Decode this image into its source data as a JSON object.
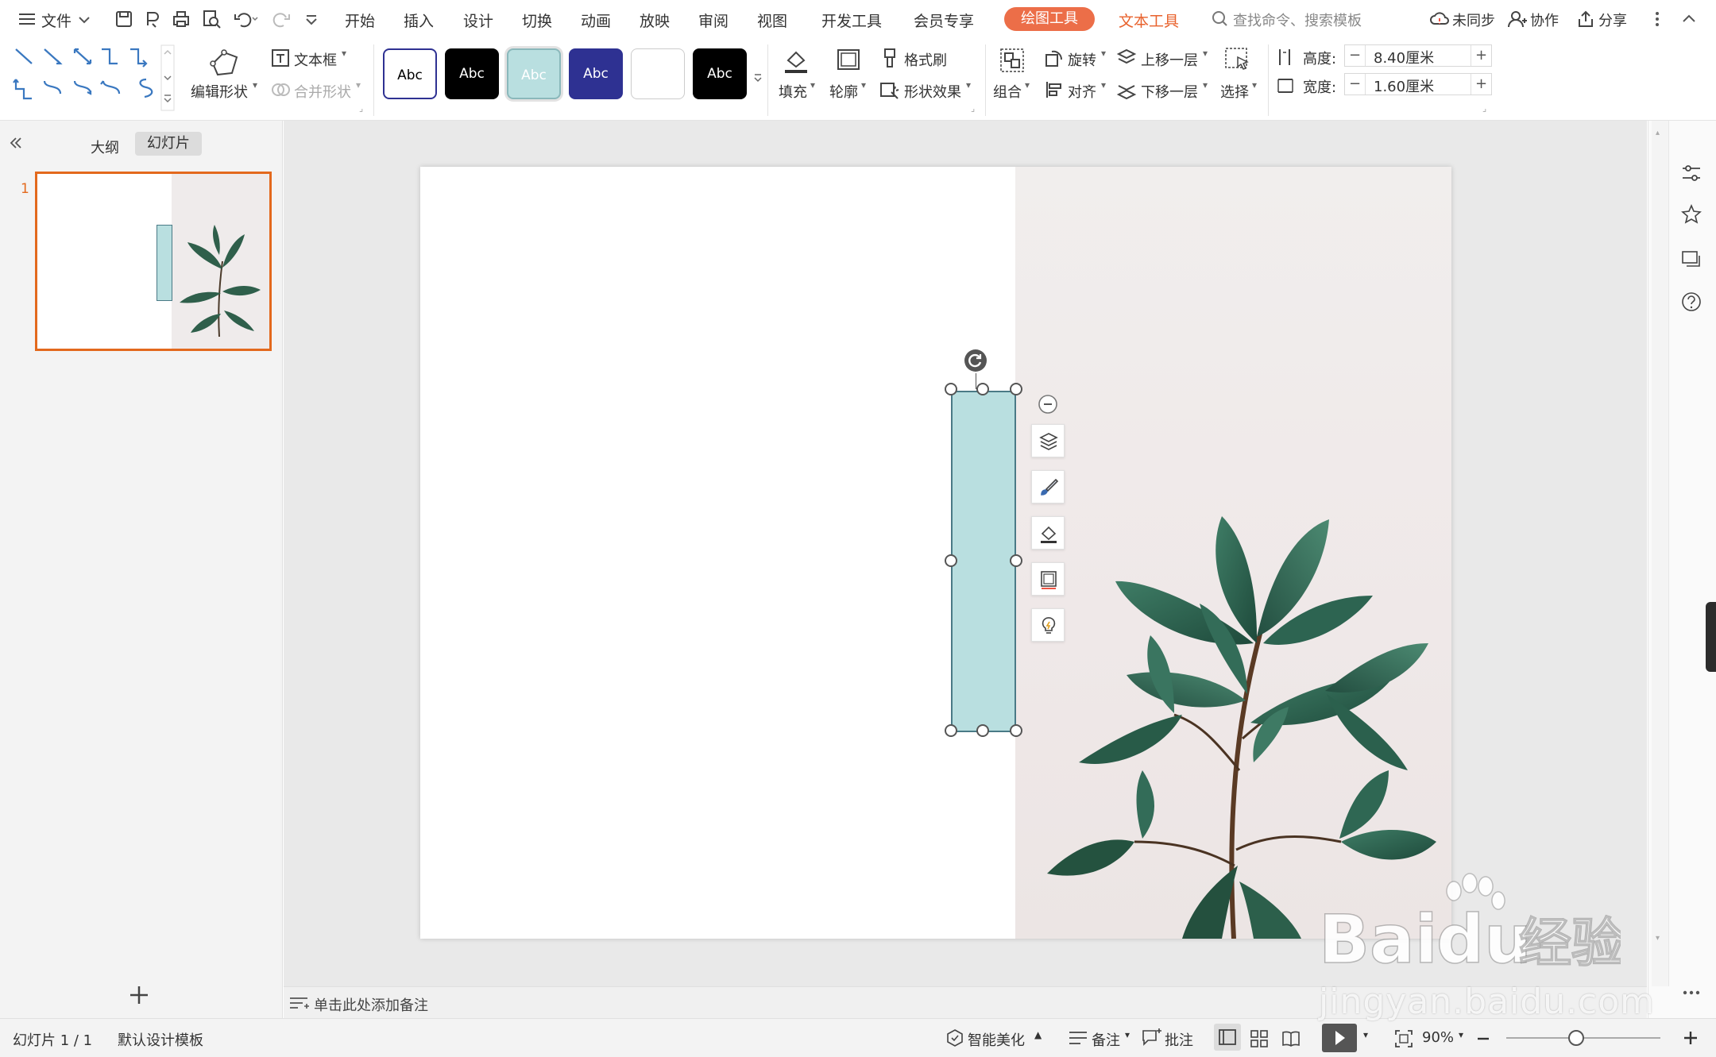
{
  "menubar": {
    "file_label": "文件",
    "tabs": [
      "开始",
      "插入",
      "设计",
      "切换",
      "动画",
      "放映",
      "审阅",
      "视图",
      "开发工具",
      "会员专享"
    ],
    "drawing_tools": "绘图工具",
    "text_tools": "文本工具",
    "search_placeholder": "查找命令、搜索模板",
    "sync_label": "未同步",
    "collab_label": "协作",
    "share_label": "分享"
  },
  "ribbon": {
    "edit_shape": "编辑形状",
    "textbox": "文本框",
    "merge_shape": "合并形状",
    "style_sample_text": "Abc",
    "fill": "填充",
    "outline": "轮廓",
    "format_painter": "格式刷",
    "shape_effects": "形状效果",
    "group": "组合",
    "rotate": "旋转",
    "align": "对齐",
    "bring_forward": "上移一层",
    "send_backward": "下移一层",
    "select": "选择",
    "height_label": "高度:",
    "height_value": "8.40厘米",
    "width_label": "宽度:",
    "width_value": "1.60厘米"
  },
  "left_panel": {
    "outline_tab": "大纲",
    "slides_tab": "幻灯片",
    "slide_number": "1"
  },
  "notes": {
    "placeholder": "单击此处添加备注"
  },
  "statusbar": {
    "slide_counter": "幻灯片 1 / 1",
    "template": "默认设计模板",
    "smart_beautify": "智能美化",
    "notes": "备注",
    "comments": "批注",
    "zoom": "90%"
  },
  "watermark": {
    "brand": "Bai经验",
    "url": "jingyan.baidu.com"
  },
  "colors": {
    "accent_orange": "#ec6e48",
    "shape_fill": "#b9dfe0",
    "selection_border": "#e3691d",
    "style_navy": "#2e3192"
  }
}
